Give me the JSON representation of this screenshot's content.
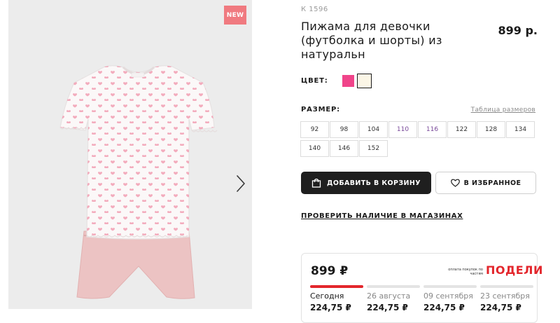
{
  "product": {
    "badge": "NEW",
    "article": "К 1596",
    "title": "Пижама для девочки (футболка и шорты) из натуральн",
    "price": "899 р."
  },
  "color": {
    "label": "ЦВЕТ:",
    "options": [
      {
        "name": "pink",
        "hex": "#f0448a"
      },
      {
        "name": "cream",
        "hex": "#fbf6e6",
        "selected": true
      }
    ]
  },
  "size": {
    "label": "РАЗМЕР:",
    "table_link": "Таблица размеров",
    "options": [
      "92",
      "98",
      "104",
      "110",
      "116",
      "122",
      "128",
      "134",
      "140",
      "146",
      "152"
    ]
  },
  "actions": {
    "add_to_cart": "ДОБАВИТЬ В КОРЗИНУ",
    "favorite": "В ИЗБРАННОЕ",
    "check_stores": "ПРОВЕРИТЬ НАЛИЧИЕ В МАГАЗИНАХ"
  },
  "installment": {
    "total": "899 ₽",
    "note": "оплата покупок по частям",
    "provider": "ПОДЕЛИ",
    "payments": [
      {
        "date": "Сегодня",
        "amount": "224,75 ₽"
      },
      {
        "date": "26 августа",
        "amount": "224,75 ₽"
      },
      {
        "date": "09 сентября",
        "amount": "224,75 ₽"
      },
      {
        "date": "23 сентября",
        "amount": "224,75 ₽"
      }
    ]
  },
  "icons": {
    "next": "chevron-right-icon",
    "cart": "bag-icon",
    "favorite": "heart-icon"
  },
  "colors": {
    "badge": "#f07a80",
    "accent": "#e3262c",
    "button_dark": "#1f1f1f"
  }
}
